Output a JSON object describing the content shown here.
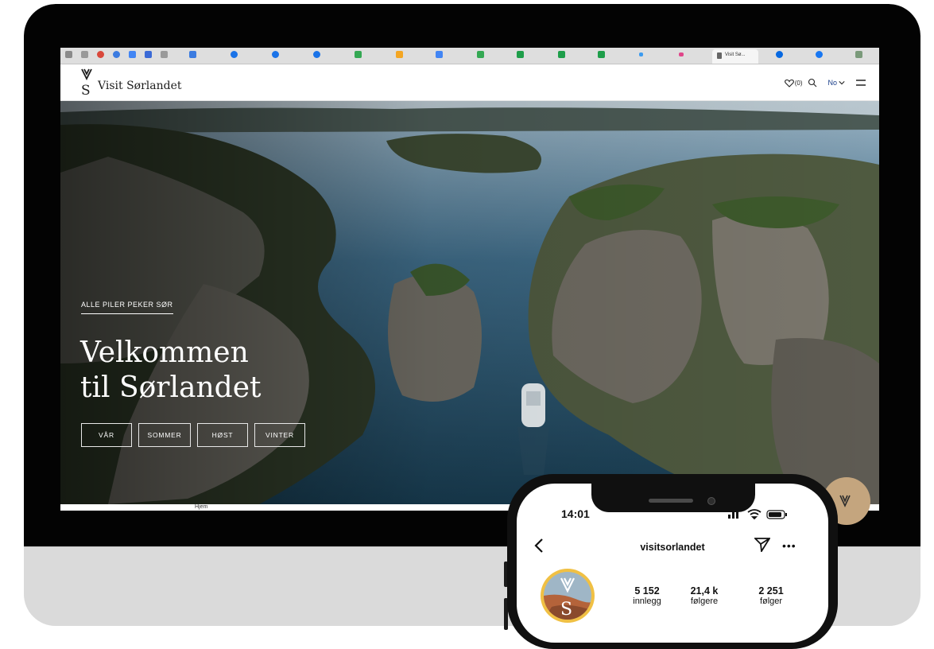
{
  "browser": {
    "active_tab_label": "Visit Sø..."
  },
  "site": {
    "logo_text": "Visit Sørlandet",
    "favorites_count": "(0)",
    "language": "No"
  },
  "hero": {
    "eyebrow": "ALLE PILER PEKER SØR",
    "title_line1": "Velkommen",
    "title_line2": "til Sørlandet",
    "seasons": [
      "VÅR",
      "SOMMER",
      "HØST",
      "VINTER"
    ]
  },
  "subnav": {
    "home": "Hjem"
  },
  "phone": {
    "time": "14:01",
    "username": "visitsorlandet",
    "stats": [
      {
        "value": "5 152",
        "label": "innlegg"
      },
      {
        "value": "21,4 k",
        "label": "følgere"
      },
      {
        "value": "2 251",
        "label": "følger"
      }
    ]
  },
  "colors": {
    "bezel": "#030303",
    "stand": "#dadada",
    "link_blue": "#1a3f8a",
    "avatar_ring": "#f0c044",
    "badge": "#c4a57e"
  }
}
